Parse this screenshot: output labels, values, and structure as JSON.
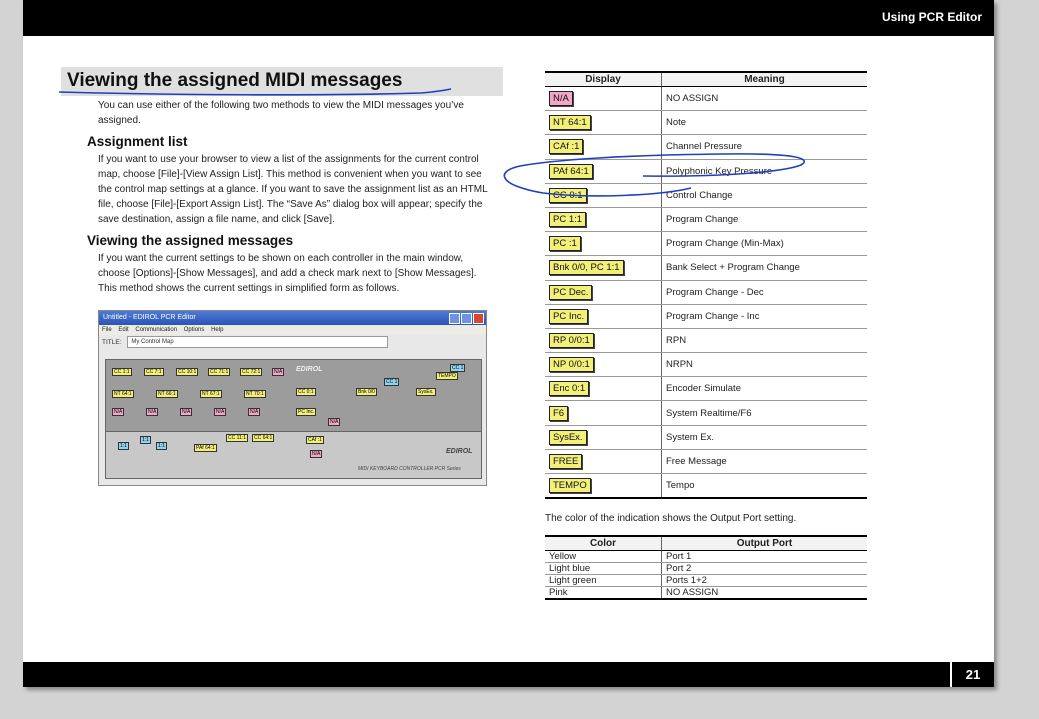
{
  "header": {
    "section_title": "Using PCR Editor"
  },
  "footer": {
    "page_number": "21"
  },
  "left": {
    "heading": "Viewing the assigned MIDI messages",
    "intro": "You can use either of the following two methods to view the MIDI messages you’ve assigned.",
    "section1": {
      "title": "Assignment list",
      "body": "If you want to use your browser to view a list of the assignments for the current control map, choose [File]-[View Assign List]. This method is convenient when you want to see the control map settings at a glance. If you want to save the assignment list as an HTML file, choose [File]-[Export Assign List]. The “Save As” dialog box will appear; specify the save destination, assign a file name, and click [Save]."
    },
    "section2": {
      "title": "Viewing the assigned messages",
      "body": "If you want the current settings to be shown on each controller in the main window, choose [Options]-[Show Messages], and add a check mark next to [Show Messages]. This method shows the current settings in simplified form as follows."
    },
    "screenshot": {
      "window_title": "Untitled - EDIROL PCR Editor",
      "menu": [
        "File",
        "Edit",
        "Communication",
        "Options",
        "Help"
      ],
      "title_label": "TITLE:",
      "title_value": "My Control Map",
      "brand": "EDIROL",
      "model_caption": "MIDI KEYBOARD CONTROLLER PCR Series"
    }
  },
  "display_table": {
    "headers": [
      "Display",
      "Meaning"
    ],
    "rows": [
      {
        "display": "N/A",
        "color": "pink",
        "meaning": "NO ASSIGN"
      },
      {
        "display": "NT 64:1",
        "color": "yellow",
        "meaning": "Note"
      },
      {
        "display": "CAf :1",
        "color": "yellow",
        "meaning": "Channel Pressure"
      },
      {
        "display": "PAf 64:1",
        "color": "yellow",
        "meaning": "Polyphonic Key Pressure"
      },
      {
        "display": "CC 0:1",
        "color": "yellow",
        "meaning": "Control Change"
      },
      {
        "display": "PC 1:1",
        "color": "yellow",
        "meaning": "Program Change"
      },
      {
        "display": "PC :1",
        "color": "yellow",
        "meaning": "Program Change (Min-Max)"
      },
      {
        "display": "Bnk 0/0, PC 1:1",
        "color": "yellow",
        "meaning": "Bank Select + Program Change"
      },
      {
        "display": "PC Dec.",
        "color": "yellow",
        "meaning": "Program Change - Dec"
      },
      {
        "display": "PC Inc.",
        "color": "yellow",
        "meaning": "Program Change - Inc"
      },
      {
        "display": "RP 0/0:1",
        "color": "yellow",
        "meaning": "RPN"
      },
      {
        "display": "NP 0/0:1",
        "color": "yellow",
        "meaning": "NRPN"
      },
      {
        "display": "Enc 0:1",
        "color": "yellow",
        "meaning": "Encoder Simulate"
      },
      {
        "display": "F6",
        "color": "yellow",
        "meaning": "System Realtime/F6"
      },
      {
        "display": "SysEx.",
        "color": "yellow",
        "meaning": "System Ex."
      },
      {
        "display": "FREE",
        "color": "yellow",
        "meaning": "Free Message"
      },
      {
        "display": "TEMPO",
        "color": "yellow",
        "meaning": "Tempo"
      }
    ]
  },
  "color_note": "The color of the indication shows the Output Port setting.",
  "color_table": {
    "headers": [
      "Color",
      "Output Port"
    ],
    "rows": [
      {
        "color": "Yellow",
        "port": "Port 1"
      },
      {
        "color": "Light blue",
        "port": "Port 2"
      },
      {
        "color": "Light green",
        "port": "Ports 1+2"
      },
      {
        "color": "Pink",
        "port": "NO ASSIGN"
      }
    ]
  },
  "colors": {
    "yellow_chip": "#f3f07a",
    "pink_chip": "#f3a6c6",
    "ink_blue": "#1f3fbf"
  }
}
